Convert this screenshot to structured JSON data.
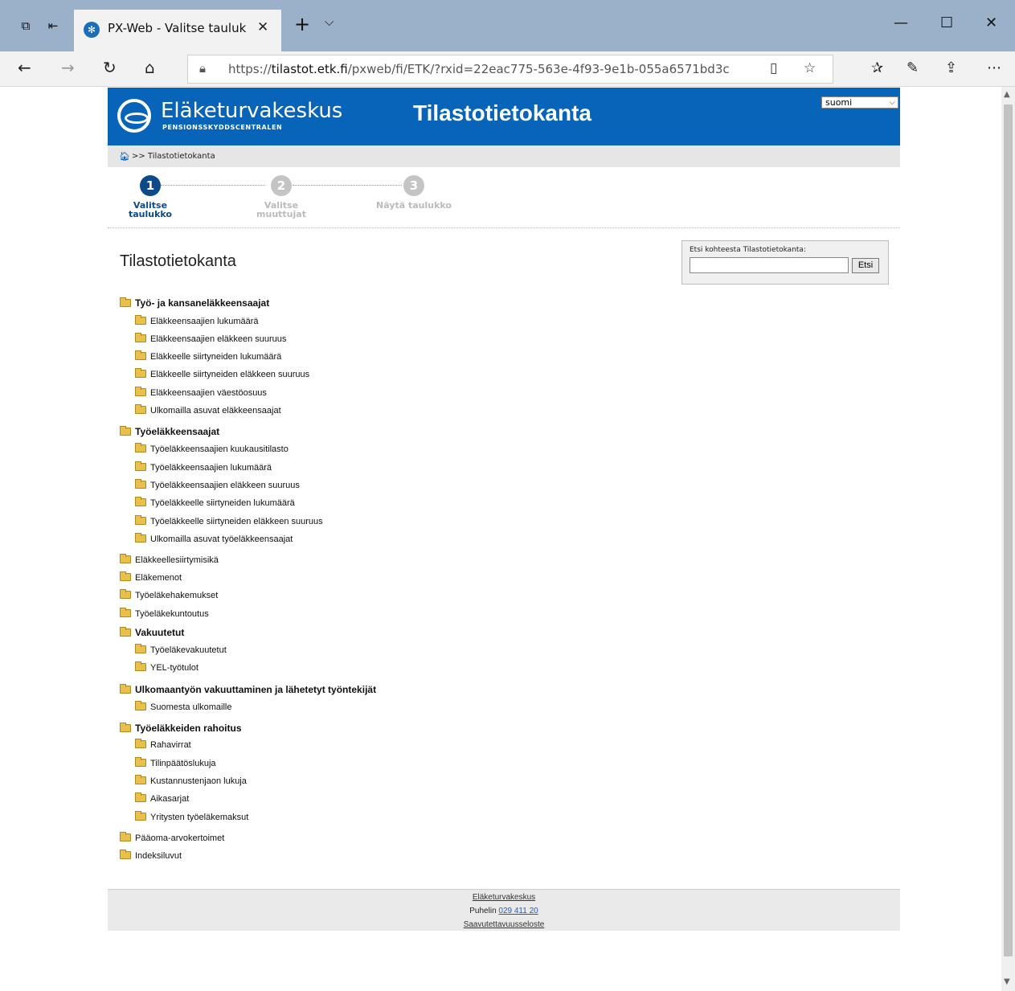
{
  "browser": {
    "tab_title": "PX-Web - Valitse tauluk",
    "url_prefix": "https://",
    "url_host": "tilastot.etk.fi",
    "url_path": "/pxweb/fi/ETK/?rxid=22eac775-563e-4f93-9e1b-055a6571bd3c"
  },
  "header": {
    "logo_name": "Eläketurvakeskus",
    "logo_sub": "PENSIONSSKYDDSCENTRALEN",
    "site_title": "Tilastotietokanta",
    "language": "suomi"
  },
  "breadcrumb": {
    "text": ">> Tilastotietokanta"
  },
  "steps": [
    {
      "number": "1",
      "label_line1": "Valitse",
      "label_line2": "taulukko"
    },
    {
      "number": "2",
      "label_line1": "Valitse",
      "label_line2": "muuttujat"
    },
    {
      "number": "3",
      "label_line1": "Näytä taulukko",
      "label_line2": ""
    }
  ],
  "page_title": "Tilastotietokanta",
  "search": {
    "label": "Etsi kohteesta Tilastotietokanta:",
    "value": "",
    "button": "Etsi"
  },
  "tree": [
    "Työ- ja kansaneläkkeensaajat",
    "Eläkkeensaajien lukumäärä",
    "Eläkkeensaajien eläkkeen suuruus",
    "Eläkkeelle siirtyneiden lukumäärä",
    "Eläkkeelle siirtyneiden eläkkeen suuruus",
    "Eläkkeensaajien väestöosuus",
    "Ulkomailla asuvat eläkkeensaajat",
    "Työeläkkeensaajat",
    "Työeläkkeensaajien kuukausitilasto",
    "Työeläkkeensaajien lukumäärä",
    "Työeläkkeensaajien eläkkeen suuruus",
    "Työeläkkeelle siirtyneiden lukumäärä",
    "Työeläkkeelle siirtyneiden eläkkeen suuruus",
    "Ulkomailla asuvat työeläkkeensaajat",
    "Eläkkeellesiirtymisikä",
    "Eläkemenot",
    "Työeläkehakemukset",
    "Työeläkekuntoutus",
    "Vakuutetut",
    "Työeläkevakuutetut",
    "YEL-työtulot",
    "Ulkomaantyön vakuuttaminen ja lähetetyt työntekijät",
    "Suomesta ulkomaille",
    "Työeläkkeiden rahoitus",
    "Rahavirrat",
    "Tilinpäätöslukuja",
    "Kustannustenjaon lukuja",
    "Aikasarjat",
    "Yritysten työeläkemaksut",
    "Pääoma-arvokertoimet",
    "Indeksiluvut"
  ],
  "footer": {
    "org": "Eläketurvakeskus",
    "phone_label": "Puhelin",
    "phone": "029 411 20",
    "accessibility": "Saavutettavuusseloste"
  },
  "colors": {
    "header_blue": "#0764b8",
    "step_active": "#0c4a8a"
  }
}
